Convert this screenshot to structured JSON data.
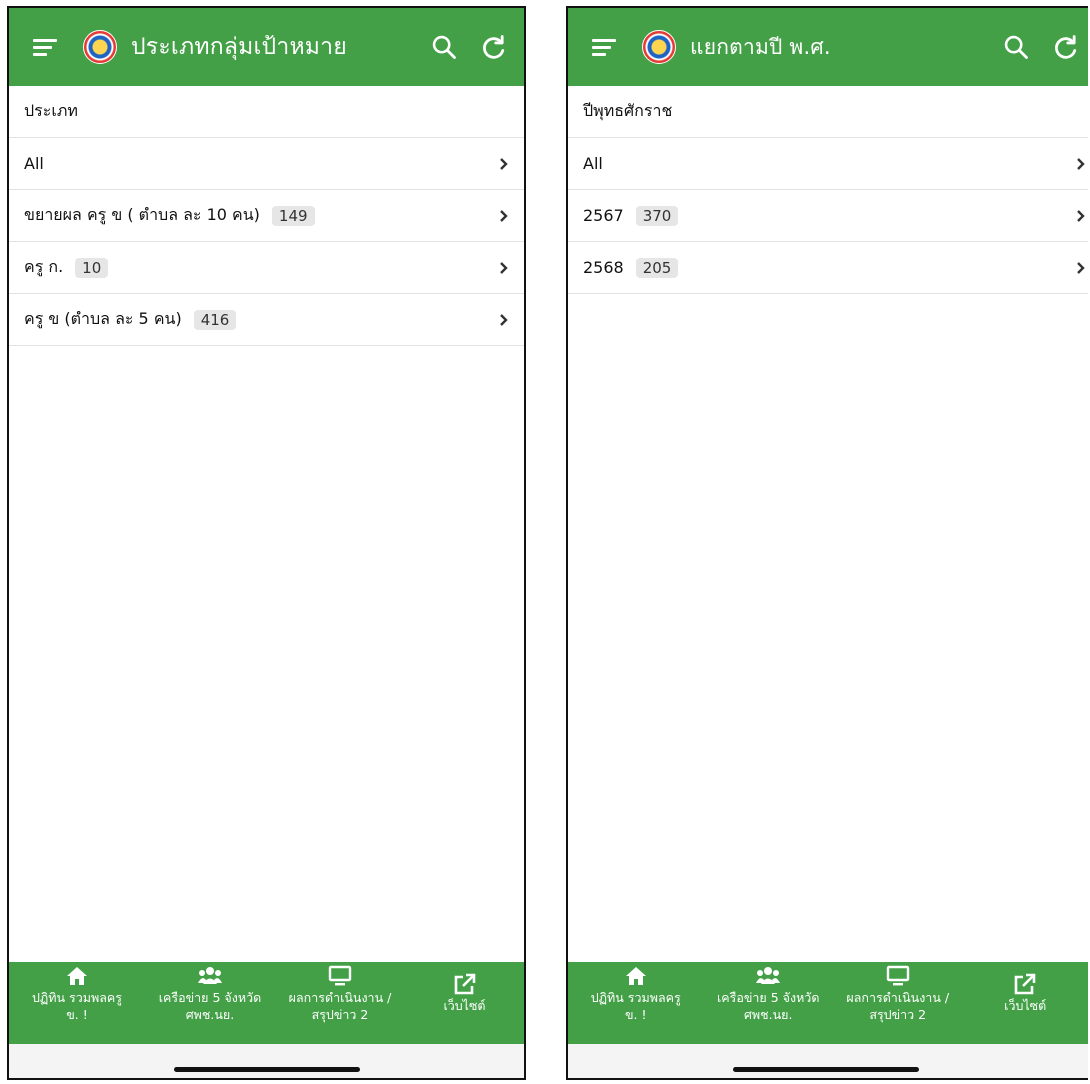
{
  "screens": [
    {
      "title": "ประเภทกลุ่มเป้าหมาย",
      "section_label": "ประเภท",
      "items": [
        {
          "label": "All",
          "count": ""
        },
        {
          "label": "ขยายผล ครู ข ( ตำบล ละ 10 คน)",
          "count": "149"
        },
        {
          "label": "ครู ก.",
          "count": "10"
        },
        {
          "label": "ครู ข (ตำบล ละ 5 คน)",
          "count": "416"
        }
      ]
    },
    {
      "title": "แยกตามปี พ.ศ.",
      "section_label": "ปีพุทธศักราช",
      "items": [
        {
          "label": "All",
          "count": ""
        },
        {
          "label": "2567",
          "count": "370"
        },
        {
          "label": "2568",
          "count": "205"
        }
      ]
    }
  ],
  "bottom_nav": [
    {
      "label": "ปฏิทิน รวมพลครู\nข. !",
      "icon": "home-icon"
    },
    {
      "label": "เครือข่าย 5 จังหวัด\nศพช.นย.",
      "icon": "users-icon"
    },
    {
      "label": "ผลการดำเนินงาน /\nสรุปข่าว 2",
      "icon": "monitor-icon"
    },
    {
      "label": "เว็บไซต์",
      "icon": "external-link-icon"
    }
  ],
  "icons": {
    "menu": "menu-icon",
    "search": "search-icon",
    "refresh": "refresh-icon",
    "chevron": "chevron-right-icon"
  },
  "colors": {
    "appbar": "#43a047",
    "badge_bg": "#e6e6e6",
    "divider": "#e2e2e2"
  }
}
